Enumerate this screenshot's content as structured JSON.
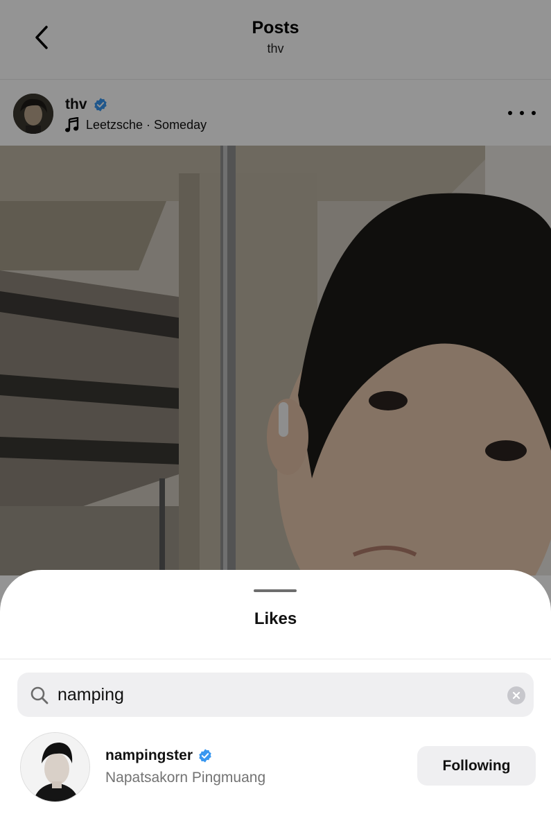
{
  "topbar": {
    "title": "Posts",
    "subtitle": "thv"
  },
  "post": {
    "username": "thv",
    "verified": true,
    "music": "Leetzsche · Someday"
  },
  "likes_sheet": {
    "title": "Likes",
    "search": {
      "value": "namping",
      "placeholder": "Search"
    },
    "results": [
      {
        "username": "nampingster",
        "verified": true,
        "full_name": "Napatsakorn Pingmuang",
        "button_label": "Following"
      }
    ]
  },
  "colors": {
    "verified_blue": "#3897f0",
    "dim_overlay": "rgba(0,0,0,0.42)",
    "button_bg": "#efeff1"
  }
}
